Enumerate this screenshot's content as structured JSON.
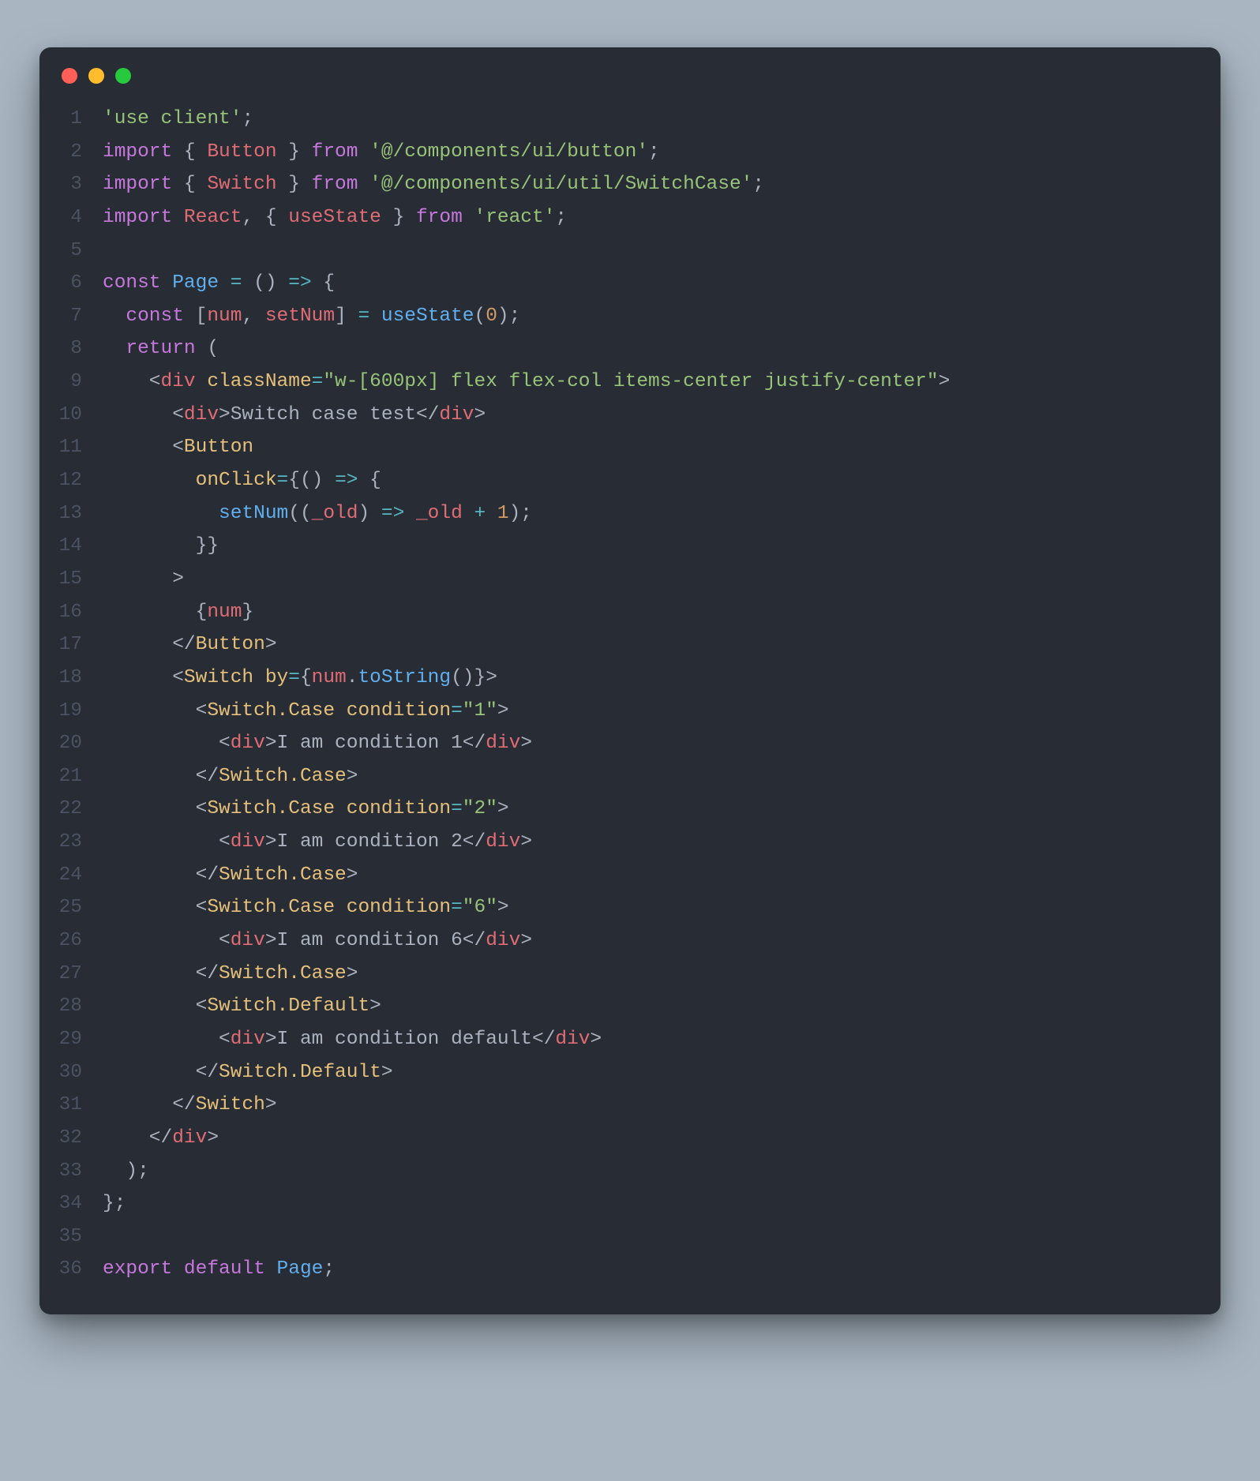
{
  "window": {
    "traffic_lights": [
      "red",
      "yellow",
      "green"
    ]
  },
  "code": {
    "lines": [
      {
        "n": 1,
        "tokens": [
          [
            "green",
            "'use client'"
          ],
          [
            "grey",
            ";"
          ]
        ]
      },
      {
        "n": 2,
        "tokens": [
          [
            "kw",
            "import"
          ],
          [
            "grey",
            " { "
          ],
          [
            "red",
            "Button"
          ],
          [
            "grey",
            " } "
          ],
          [
            "kw",
            "from"
          ],
          [
            "grey",
            " "
          ],
          [
            "green",
            "'@/components/ui/button'"
          ],
          [
            "grey",
            ";"
          ]
        ]
      },
      {
        "n": 3,
        "tokens": [
          [
            "kw",
            "import"
          ],
          [
            "grey",
            " { "
          ],
          [
            "red",
            "Switch"
          ],
          [
            "grey",
            " } "
          ],
          [
            "kw",
            "from"
          ],
          [
            "grey",
            " "
          ],
          [
            "green",
            "'@/components/ui/util/SwitchCase'"
          ],
          [
            "grey",
            ";"
          ]
        ]
      },
      {
        "n": 4,
        "tokens": [
          [
            "kw",
            "import"
          ],
          [
            "grey",
            " "
          ],
          [
            "red",
            "React"
          ],
          [
            "grey",
            ", { "
          ],
          [
            "red",
            "useState"
          ],
          [
            "grey",
            " } "
          ],
          [
            "kw",
            "from"
          ],
          [
            "grey",
            " "
          ],
          [
            "green",
            "'react'"
          ],
          [
            "grey",
            ";"
          ]
        ]
      },
      {
        "n": 5,
        "tokens": [
          [
            "grey",
            ""
          ]
        ]
      },
      {
        "n": 6,
        "tokens": [
          [
            "kw",
            "const"
          ],
          [
            "grey",
            " "
          ],
          [
            "blue",
            "Page"
          ],
          [
            "grey",
            " "
          ],
          [
            "cyan",
            "="
          ],
          [
            "grey",
            " () "
          ],
          [
            "cyan",
            "=>"
          ],
          [
            "grey",
            " {"
          ]
        ]
      },
      {
        "n": 7,
        "tokens": [
          [
            "grey",
            "  "
          ],
          [
            "kw",
            "const"
          ],
          [
            "grey",
            " ["
          ],
          [
            "red",
            "num"
          ],
          [
            "grey",
            ", "
          ],
          [
            "red",
            "setNum"
          ],
          [
            "grey",
            "] "
          ],
          [
            "cyan",
            "="
          ],
          [
            "grey",
            " "
          ],
          [
            "blue",
            "useState"
          ],
          [
            "grey",
            "("
          ],
          [
            "orange",
            "0"
          ],
          [
            "grey",
            ");"
          ]
        ]
      },
      {
        "n": 8,
        "tokens": [
          [
            "grey",
            "  "
          ],
          [
            "kw",
            "return"
          ],
          [
            "grey",
            " ("
          ]
        ]
      },
      {
        "n": 9,
        "tokens": [
          [
            "grey",
            "    <"
          ],
          [
            "red",
            "div"
          ],
          [
            "grey",
            " "
          ],
          [
            "yellow",
            "className"
          ],
          [
            "cyan",
            "="
          ],
          [
            "green",
            "\"w-[600px] flex flex-col items-center justify-center\""
          ],
          [
            "grey",
            ">"
          ]
        ]
      },
      {
        "n": 10,
        "tokens": [
          [
            "grey",
            "      <"
          ],
          [
            "red",
            "div"
          ],
          [
            "grey",
            ">Switch case test</"
          ],
          [
            "red",
            "div"
          ],
          [
            "grey",
            ">"
          ]
        ]
      },
      {
        "n": 11,
        "tokens": [
          [
            "grey",
            "      <"
          ],
          [
            "yellow",
            "Button"
          ]
        ]
      },
      {
        "n": 12,
        "tokens": [
          [
            "grey",
            "        "
          ],
          [
            "yellow",
            "onClick"
          ],
          [
            "cyan",
            "="
          ],
          [
            "grey",
            "{() "
          ],
          [
            "cyan",
            "=>"
          ],
          [
            "grey",
            " {"
          ]
        ]
      },
      {
        "n": 13,
        "tokens": [
          [
            "grey",
            "          "
          ],
          [
            "blue",
            "setNum"
          ],
          [
            "grey",
            "(("
          ],
          [
            "red",
            "_old"
          ],
          [
            "grey",
            ") "
          ],
          [
            "cyan",
            "=>"
          ],
          [
            "grey",
            " "
          ],
          [
            "red",
            "_old"
          ],
          [
            "grey",
            " "
          ],
          [
            "cyan",
            "+"
          ],
          [
            "grey",
            " "
          ],
          [
            "orange",
            "1"
          ],
          [
            "grey",
            ");"
          ]
        ]
      },
      {
        "n": 14,
        "tokens": [
          [
            "grey",
            "        }}"
          ]
        ]
      },
      {
        "n": 15,
        "tokens": [
          [
            "grey",
            "      >"
          ]
        ]
      },
      {
        "n": 16,
        "tokens": [
          [
            "grey",
            "        {"
          ],
          [
            "red",
            "num"
          ],
          [
            "grey",
            "}"
          ]
        ]
      },
      {
        "n": 17,
        "tokens": [
          [
            "grey",
            "      </"
          ],
          [
            "yellow",
            "Button"
          ],
          [
            "grey",
            ">"
          ]
        ]
      },
      {
        "n": 18,
        "tokens": [
          [
            "grey",
            "      <"
          ],
          [
            "yellow",
            "Switch"
          ],
          [
            "grey",
            " "
          ],
          [
            "yellow",
            "by"
          ],
          [
            "cyan",
            "="
          ],
          [
            "grey",
            "{"
          ],
          [
            "red",
            "num"
          ],
          [
            "grey",
            "."
          ],
          [
            "blue",
            "toString"
          ],
          [
            "grey",
            "()}>"
          ]
        ]
      },
      {
        "n": 19,
        "tokens": [
          [
            "grey",
            "        <"
          ],
          [
            "yellow",
            "Switch.Case"
          ],
          [
            "grey",
            " "
          ],
          [
            "yellow",
            "condition"
          ],
          [
            "cyan",
            "="
          ],
          [
            "green",
            "\"1\""
          ],
          [
            "grey",
            ">"
          ]
        ]
      },
      {
        "n": 20,
        "tokens": [
          [
            "grey",
            "          <"
          ],
          [
            "red",
            "div"
          ],
          [
            "grey",
            ">I am condition 1</"
          ],
          [
            "red",
            "div"
          ],
          [
            "grey",
            ">"
          ]
        ]
      },
      {
        "n": 21,
        "tokens": [
          [
            "grey",
            "        </"
          ],
          [
            "yellow",
            "Switch.Case"
          ],
          [
            "grey",
            ">"
          ]
        ]
      },
      {
        "n": 22,
        "tokens": [
          [
            "grey",
            "        <"
          ],
          [
            "yellow",
            "Switch.Case"
          ],
          [
            "grey",
            " "
          ],
          [
            "yellow",
            "condition"
          ],
          [
            "cyan",
            "="
          ],
          [
            "green",
            "\"2\""
          ],
          [
            "grey",
            ">"
          ]
        ]
      },
      {
        "n": 23,
        "tokens": [
          [
            "grey",
            "          <"
          ],
          [
            "red",
            "div"
          ],
          [
            "grey",
            ">I am condition 2</"
          ],
          [
            "red",
            "div"
          ],
          [
            "grey",
            ">"
          ]
        ]
      },
      {
        "n": 24,
        "tokens": [
          [
            "grey",
            "        </"
          ],
          [
            "yellow",
            "Switch.Case"
          ],
          [
            "grey",
            ">"
          ]
        ]
      },
      {
        "n": 25,
        "tokens": [
          [
            "grey",
            "        <"
          ],
          [
            "yellow",
            "Switch.Case"
          ],
          [
            "grey",
            " "
          ],
          [
            "yellow",
            "condition"
          ],
          [
            "cyan",
            "="
          ],
          [
            "green",
            "\"6\""
          ],
          [
            "grey",
            ">"
          ]
        ]
      },
      {
        "n": 26,
        "tokens": [
          [
            "grey",
            "          <"
          ],
          [
            "red",
            "div"
          ],
          [
            "grey",
            ">I am condition 6</"
          ],
          [
            "red",
            "div"
          ],
          [
            "grey",
            ">"
          ]
        ]
      },
      {
        "n": 27,
        "tokens": [
          [
            "grey",
            "        </"
          ],
          [
            "yellow",
            "Switch.Case"
          ],
          [
            "grey",
            ">"
          ]
        ]
      },
      {
        "n": 28,
        "tokens": [
          [
            "grey",
            "        <"
          ],
          [
            "yellow",
            "Switch.Default"
          ],
          [
            "grey",
            ">"
          ]
        ]
      },
      {
        "n": 29,
        "tokens": [
          [
            "grey",
            "          <"
          ],
          [
            "red",
            "div"
          ],
          [
            "grey",
            ">I am condition default</"
          ],
          [
            "red",
            "div"
          ],
          [
            "grey",
            ">"
          ]
        ]
      },
      {
        "n": 30,
        "tokens": [
          [
            "grey",
            "        </"
          ],
          [
            "yellow",
            "Switch.Default"
          ],
          [
            "grey",
            ">"
          ]
        ]
      },
      {
        "n": 31,
        "tokens": [
          [
            "grey",
            "      </"
          ],
          [
            "yellow",
            "Switch"
          ],
          [
            "grey",
            ">"
          ]
        ]
      },
      {
        "n": 32,
        "tokens": [
          [
            "grey",
            "    </"
          ],
          [
            "red",
            "div"
          ],
          [
            "grey",
            ">"
          ]
        ]
      },
      {
        "n": 33,
        "tokens": [
          [
            "grey",
            "  );"
          ]
        ]
      },
      {
        "n": 34,
        "tokens": [
          [
            "grey",
            "};"
          ]
        ]
      },
      {
        "n": 35,
        "tokens": [
          [
            "grey",
            ""
          ]
        ]
      },
      {
        "n": 36,
        "tokens": [
          [
            "kw",
            "export"
          ],
          [
            "grey",
            " "
          ],
          [
            "kw",
            "default"
          ],
          [
            "grey",
            " "
          ],
          [
            "blue",
            "Page"
          ],
          [
            "grey",
            ";"
          ]
        ]
      }
    ]
  }
}
